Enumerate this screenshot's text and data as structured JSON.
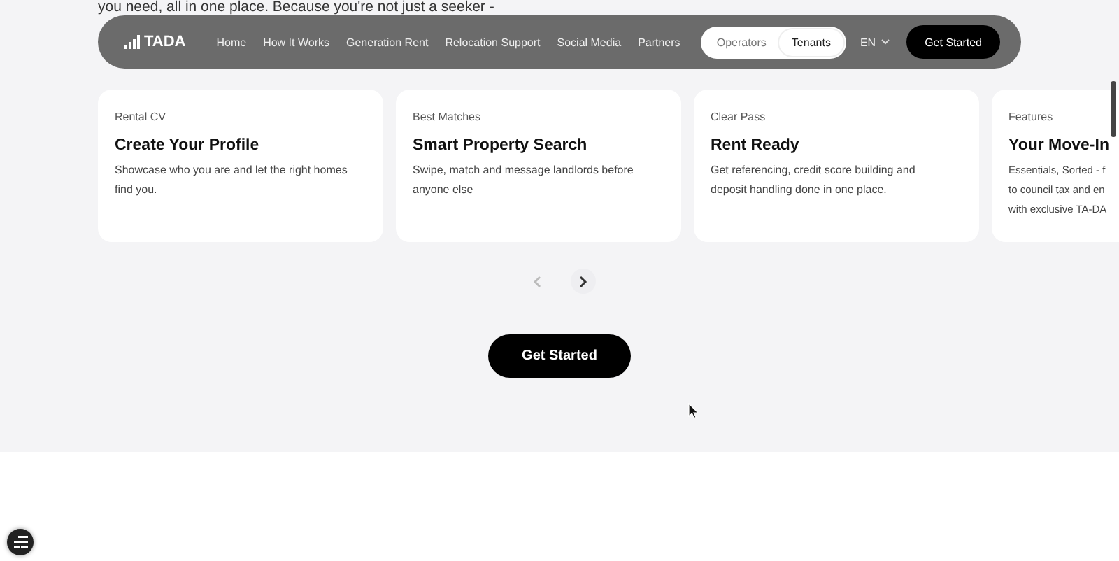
{
  "background_text": "you need, all in one place. Because you're not just a seeker -",
  "nav": {
    "logo": "TADA",
    "links": [
      {
        "label": "Home"
      },
      {
        "label": "How It Works"
      },
      {
        "label": "Generation Rent"
      },
      {
        "label": "Relocation Support"
      },
      {
        "label": "Social Media"
      },
      {
        "label": "Partners"
      }
    ],
    "audience": [
      {
        "label": "Operators",
        "selected": false
      },
      {
        "label": "Tenants",
        "selected": true
      }
    ],
    "language": "EN",
    "cta": "Get Started"
  },
  "cards": [
    {
      "eyebrow": "Rental CV",
      "title": "Create Your Profile",
      "lines": [
        "Showcase who you are and let the right homes",
        "find you."
      ]
    },
    {
      "eyebrow": "Best Matches",
      "title": "Smart Property Search",
      "lines": [
        "Swipe, match and message landlords before",
        "anyone else"
      ]
    },
    {
      "eyebrow": "Clear Pass",
      "title": "Rent Ready",
      "lines": [
        "Get referencing, credit score building and",
        "deposit handling done in one place."
      ]
    },
    {
      "eyebrow": "Features",
      "title": "Your Move-In",
      "lines": [
        "Essentials, Sorted - f",
        "to council tax and en",
        "with exclusive TA-DA"
      ]
    }
  ],
  "carousel": {
    "prev_disabled": true,
    "next_disabled": false
  },
  "cta": "Get Started"
}
